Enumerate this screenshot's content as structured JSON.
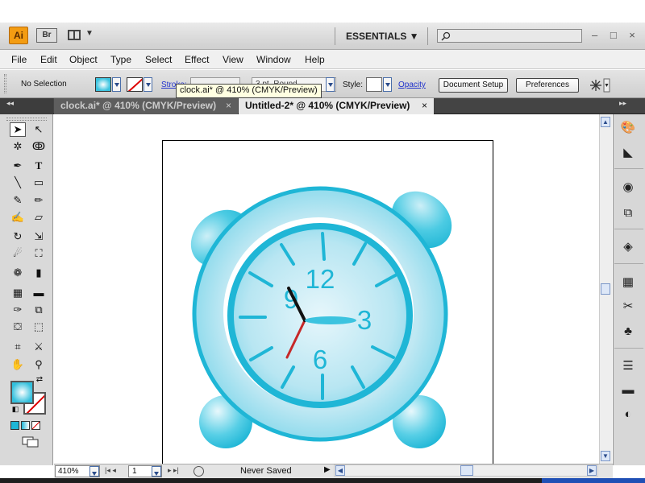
{
  "app": {
    "logo": "Ai",
    "bridge": "Br",
    "workspace": "ESSENTIALS ▼",
    "window_controls": "– □ ×"
  },
  "menu": [
    "File",
    "Edit",
    "Object",
    "Type",
    "Select",
    "Effect",
    "View",
    "Window",
    "Help"
  ],
  "control_bar": {
    "selection": "No Selection",
    "stroke_label": "Stroke:",
    "brush": "3 pt. Round",
    "style_label": "Style:",
    "opacity_label": "Opacity",
    "doc_setup": "Document Setup",
    "preferences": "Preferences"
  },
  "tooltip": "clock.ai* @ 410% (CMYK/Preview)",
  "tabs": [
    {
      "label": "clock.ai* @ 410% (CMYK/Preview)",
      "active": false,
      "close": "×"
    },
    {
      "label": "Untitled-2* @ 410% (CMYK/Preview)",
      "active": true,
      "close": "×"
    }
  ],
  "panel_collapse": {
    "left": "◂◂",
    "right": "▸▸"
  },
  "clock": {
    "n12": "12",
    "n3": "3",
    "n6": "6",
    "n9": "9"
  },
  "status": {
    "zoom": "410%",
    "page": "1",
    "nav_first": "|◂ ◂",
    "nav_last": "▸ ▸|",
    "save_state": "Never Saved",
    "arrow": "▶"
  },
  "colors": {
    "accent": "#1fb6d6",
    "fill_swatch": "#39c3df",
    "stroke_none": "#dd0000"
  }
}
